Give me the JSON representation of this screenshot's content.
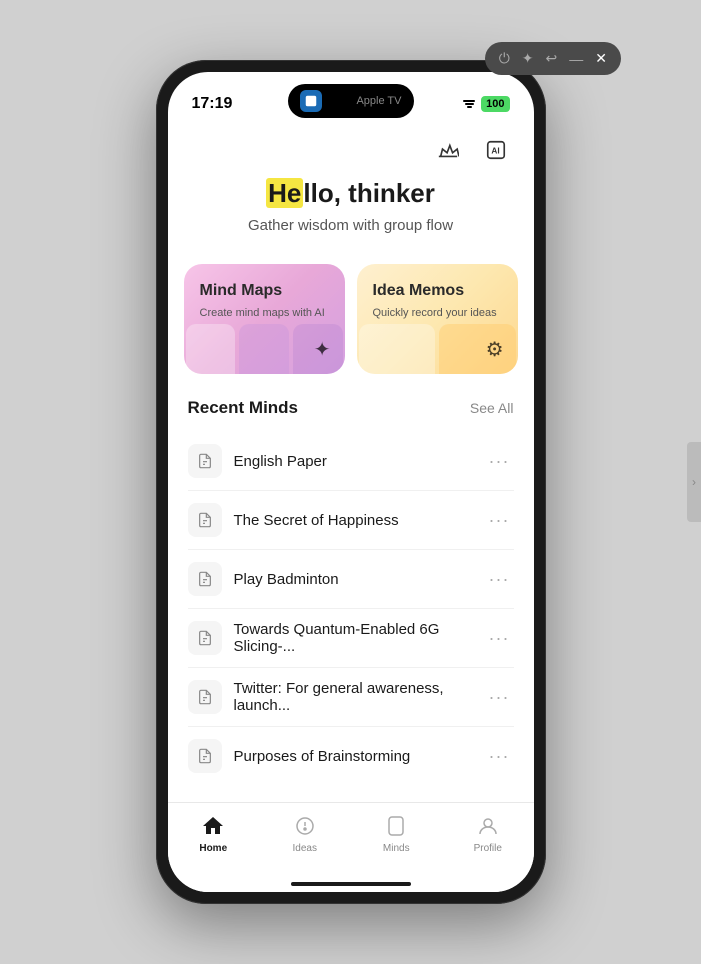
{
  "statusBar": {
    "time": "17:19",
    "battery": "100"
  },
  "header": {
    "crownIconLabel": "crown-icon",
    "aiIconLabel": "ai-icon"
  },
  "greeting": {
    "highlightText": "He",
    "restTitle": "llo, thinker",
    "subtitle": "Gather wisdom with group flow"
  },
  "cards": [
    {
      "id": "mind-maps",
      "title": "Mind Maps",
      "description": "Create mind maps with AI",
      "icon": "✦"
    },
    {
      "id": "idea-memos",
      "title": "Idea Memos",
      "description": "Quickly record your ideas",
      "icon": "⚙"
    }
  ],
  "recentSection": {
    "title": "Recent Minds",
    "seeAllLabel": "See All"
  },
  "recentItems": [
    {
      "id": 1,
      "title": "English Paper"
    },
    {
      "id": 2,
      "title": "The Secret of Happiness"
    },
    {
      "id": 3,
      "title": "Play Badminton"
    },
    {
      "id": 4,
      "title": "Towards Quantum-Enabled 6G Slicing-..."
    },
    {
      "id": 5,
      "title": "Twitter: For general awareness, launch..."
    },
    {
      "id": 6,
      "title": "Purposes of Brainstorming"
    }
  ],
  "tabBar": {
    "items": [
      {
        "id": "home",
        "label": "Home",
        "active": true
      },
      {
        "id": "ideas",
        "label": "Ideas",
        "active": false
      },
      {
        "id": "minds",
        "label": "Minds",
        "active": false
      },
      {
        "id": "profile",
        "label": "Profile",
        "active": false
      }
    ]
  }
}
